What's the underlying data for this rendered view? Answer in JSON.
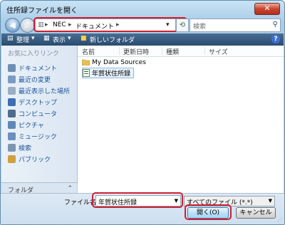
{
  "window": {
    "title": "住所録ファイルを開く",
    "close_glyph": "✕"
  },
  "nav": {
    "back_glyph": "◀",
    "forward_glyph": "▶",
    "breadcrumb": [
      "NEC",
      "ドキュメント"
    ],
    "crumb_sep": "▸",
    "dropdown_glyph": "▾",
    "refresh_glyph": "⟲",
    "search_placeholder": "検索",
    "search_glyph": "⚲"
  },
  "toolbar": {
    "organize": "整理",
    "views": "表示",
    "new_folder": "新しいフォルダ",
    "help": "?"
  },
  "sidebar": {
    "title": "お気に入りリンク",
    "items": [
      {
        "label": "ドキュメント",
        "icon": "documents-icon",
        "color": "#6d8fb5"
      },
      {
        "label": "最近の変更",
        "icon": "recent-changes-icon",
        "color": "#7a9cc4"
      },
      {
        "label": "最近表示した場所",
        "icon": "recent-places-icon",
        "color": "#9aaec4"
      },
      {
        "label": "デスクトップ",
        "icon": "desktop-icon",
        "color": "#3b6fb4"
      },
      {
        "label": "コンピュータ",
        "icon": "computer-icon",
        "color": "#4d6c8f"
      },
      {
        "label": "ピクチャ",
        "icon": "pictures-icon",
        "color": "#5d88b8"
      },
      {
        "label": "ミュージック",
        "icon": "music-icon",
        "color": "#6a8fbd"
      },
      {
        "label": "検索",
        "icon": "search-icon",
        "color": "#7d96b0"
      },
      {
        "label": "パブリック",
        "icon": "public-icon",
        "color": "#d2a03b"
      }
    ],
    "folders_label": "フォルダ",
    "folders_glyph": "⌃"
  },
  "list": {
    "columns": [
      "名前",
      "更新日時",
      "種類",
      "サイズ"
    ],
    "rows": [
      {
        "label": "My Data Sources",
        "icon": "folder-icon"
      },
      {
        "label": "年賀状住所録",
        "icon": "address-book-file-icon",
        "selected": true
      }
    ]
  },
  "bottom": {
    "filename_label": "ファイル名(N):",
    "filename_value": "年賀状住所録",
    "filetype_value": "すべてのファイル (*.*)",
    "open_label": "開く(O)",
    "cancel_label": "キャンセル"
  },
  "colors": {
    "highlight": "#d0202f",
    "toolbar": "#294b6e",
    "link": "#1a55a0"
  }
}
